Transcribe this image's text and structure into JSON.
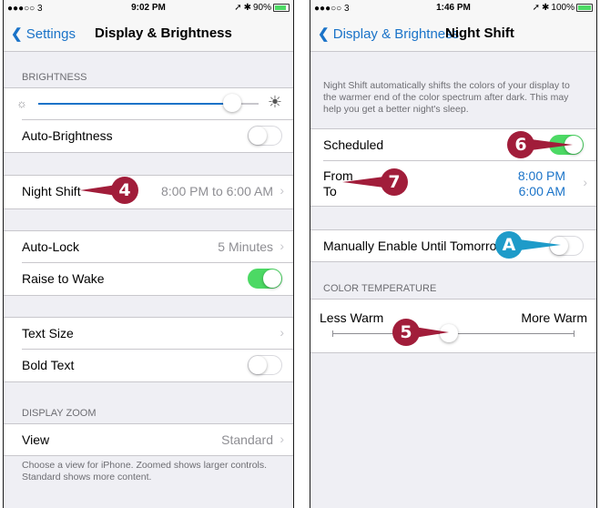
{
  "left": {
    "status": {
      "signal": "●●●○○ 3",
      "time": "9:02 PM",
      "battery": "90%"
    },
    "nav": {
      "back_label": "Settings",
      "title": "Display & Brightness"
    },
    "brightness": {
      "header": "BRIGHTNESS",
      "level": 0.88
    },
    "auto_brightness": {
      "label": "Auto-Brightness",
      "on": false
    },
    "night_shift": {
      "label": "Night Shift",
      "value": "8:00 PM to 6:00 AM"
    },
    "auto_lock": {
      "label": "Auto-Lock",
      "value": "5 Minutes"
    },
    "raise_to_wake": {
      "label": "Raise to Wake",
      "on": true
    },
    "text_size": {
      "label": "Text Size"
    },
    "bold_text": {
      "label": "Bold Text",
      "on": false
    },
    "display_zoom": {
      "header": "DISPLAY ZOOM",
      "view_label": "View",
      "view_value": "Standard",
      "footer": "Choose a view for iPhone. Zoomed shows larger controls. Standard shows more content."
    },
    "callout": "4"
  },
  "right": {
    "status": {
      "signal": "●●●○○ 3",
      "time": "1:46 PM",
      "battery": "100%"
    },
    "nav": {
      "back_label": "Display & Brightness",
      "title": "Night Shift"
    },
    "description": "Night Shift automatically shifts the colors of your display to the warmer end of the color spectrum after dark. This may help you get a better night's sleep.",
    "scheduled": {
      "label": "Scheduled",
      "on": true
    },
    "from_label": "From",
    "to_label": "To",
    "from_value": "8:00 PM",
    "to_value": "6:00 AM",
    "manual": {
      "label": "Manually Enable Until Tomorrow",
      "on": false
    },
    "color_temp": {
      "header": "COLOR TEMPERATURE",
      "less": "Less Warm",
      "more": "More Warm",
      "level": 0.48
    },
    "callouts": {
      "six": "6",
      "seven": "7",
      "a": "A",
      "five": "5"
    }
  },
  "colors": {
    "accent_blue": "#1a73c8",
    "toggle_on": "#4cd964",
    "callout_red": "#a11d3a",
    "callout_blue": "#1e9bc9"
  }
}
